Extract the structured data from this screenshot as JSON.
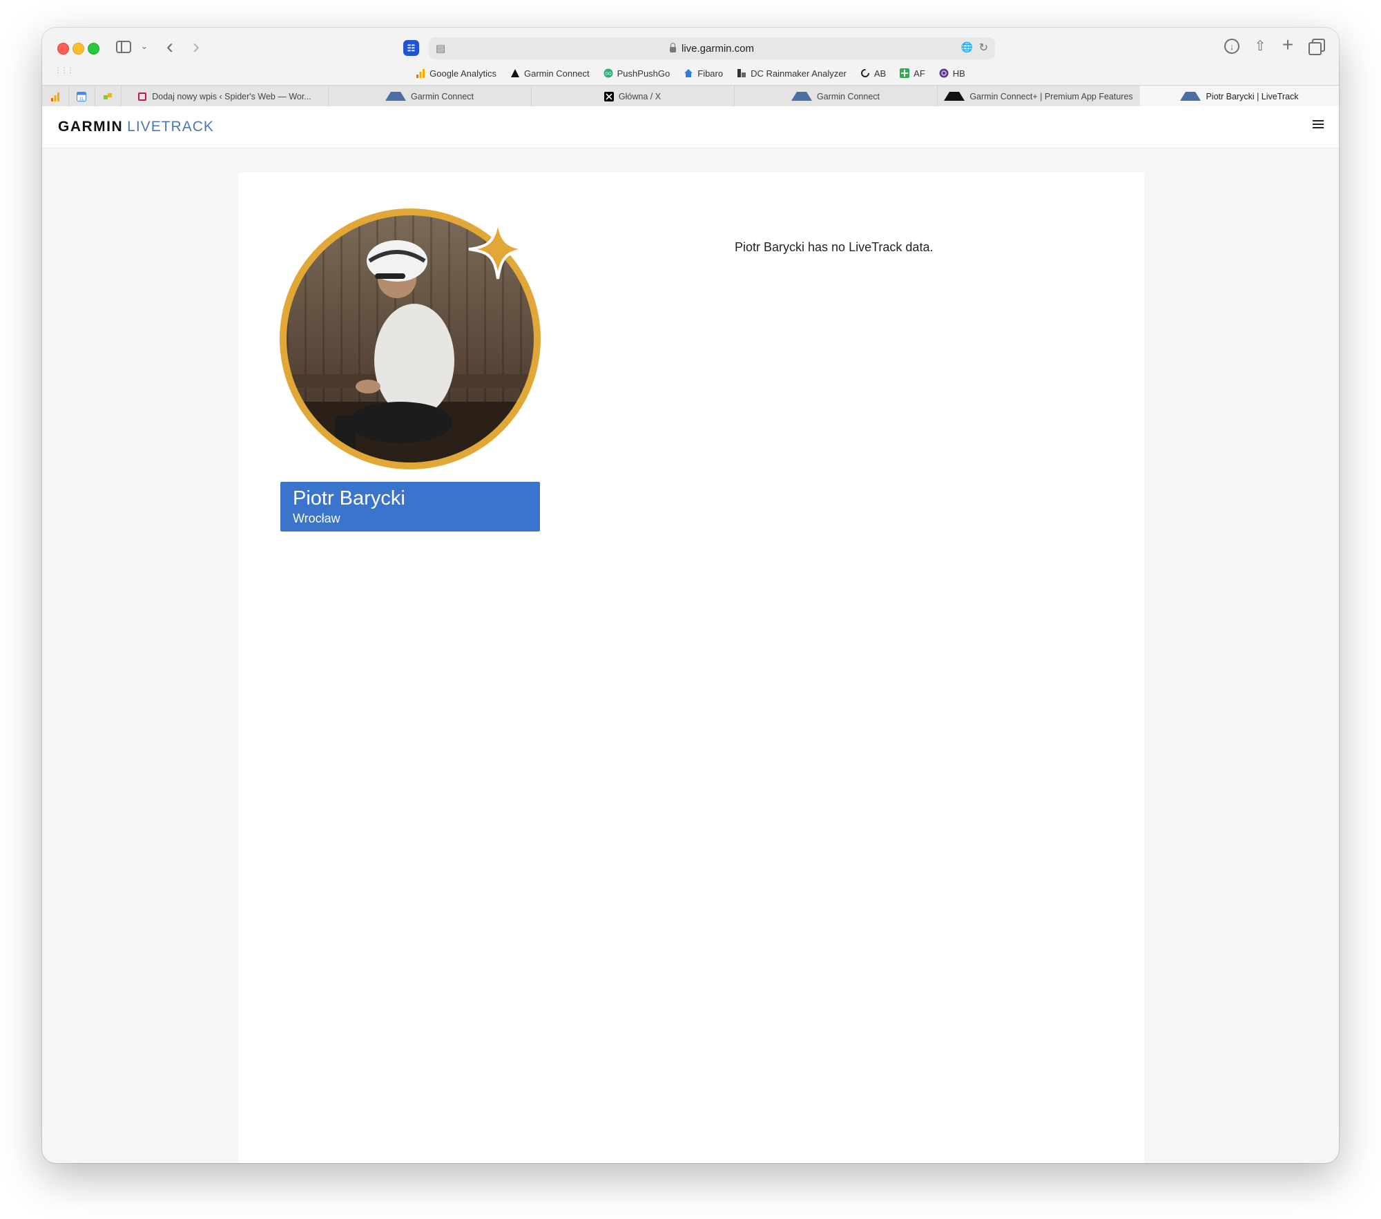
{
  "browser": {
    "url": "live.garmin.com",
    "bookmarks": [
      {
        "label": "Google Analytics",
        "icon": "analytics-icon"
      },
      {
        "label": "Garmin Connect",
        "icon": "garmin-triangle-icon"
      },
      {
        "label": "PushPushGo",
        "icon": "pushpushgo-icon"
      },
      {
        "label": "Fibaro",
        "icon": "home-icon"
      },
      {
        "label": "DC Rainmaker Analyzer",
        "icon": "analyzer-icon"
      },
      {
        "label": "AB",
        "icon": "refresh-c-icon"
      },
      {
        "label": "AF",
        "icon": "plus-green-icon"
      },
      {
        "label": "HB",
        "icon": "hb-icon"
      }
    ],
    "tabs": [
      {
        "label": "Dodaj nowy wpis ‹ Spider's Web — Wor...",
        "icon": "wordpress-icon"
      },
      {
        "label": "Garmin Connect",
        "icon": "garmin-triangle-icon"
      },
      {
        "label": "Główna / X",
        "icon": "x-icon"
      },
      {
        "label": "Garmin Connect",
        "icon": "garmin-triangle-icon"
      },
      {
        "label": "Garmin Connect+ | Premium App Features",
        "icon": "garmin-triangle-black-icon"
      },
      {
        "label": "Piotr Barycki | LiveTrack",
        "icon": "garmin-triangle-icon"
      }
    ],
    "active_tab_index": 5
  },
  "header": {
    "brand_primary": "GARMIN",
    "brand_secondary": "LIVETRACK"
  },
  "profile": {
    "name": "Piotr Barycki",
    "city": "Wrocław",
    "card_color": "#3a74cd",
    "ring_color": "#e1a838"
  },
  "main": {
    "message": "Piotr Barycki has no LiveTrack data."
  }
}
